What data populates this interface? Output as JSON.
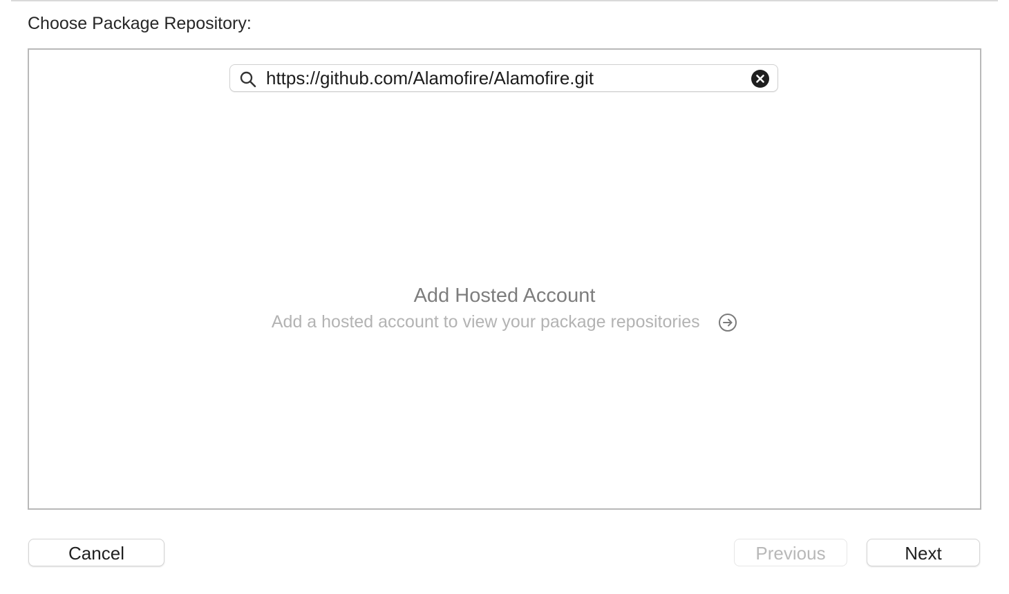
{
  "dialog": {
    "heading": "Choose Package Repository:"
  },
  "search": {
    "value": "https://github.com/Alamofire/Alamofire.git",
    "icon": "search-icon",
    "clear_icon": "clear-icon"
  },
  "empty_state": {
    "title": "Add Hosted Account",
    "subtitle": "Add a hosted account to view your package repositories",
    "link_icon": "arrow-circle-right-icon"
  },
  "buttons": {
    "cancel": "Cancel",
    "previous": "Previous",
    "next": "Next",
    "previous_enabled": false
  }
}
